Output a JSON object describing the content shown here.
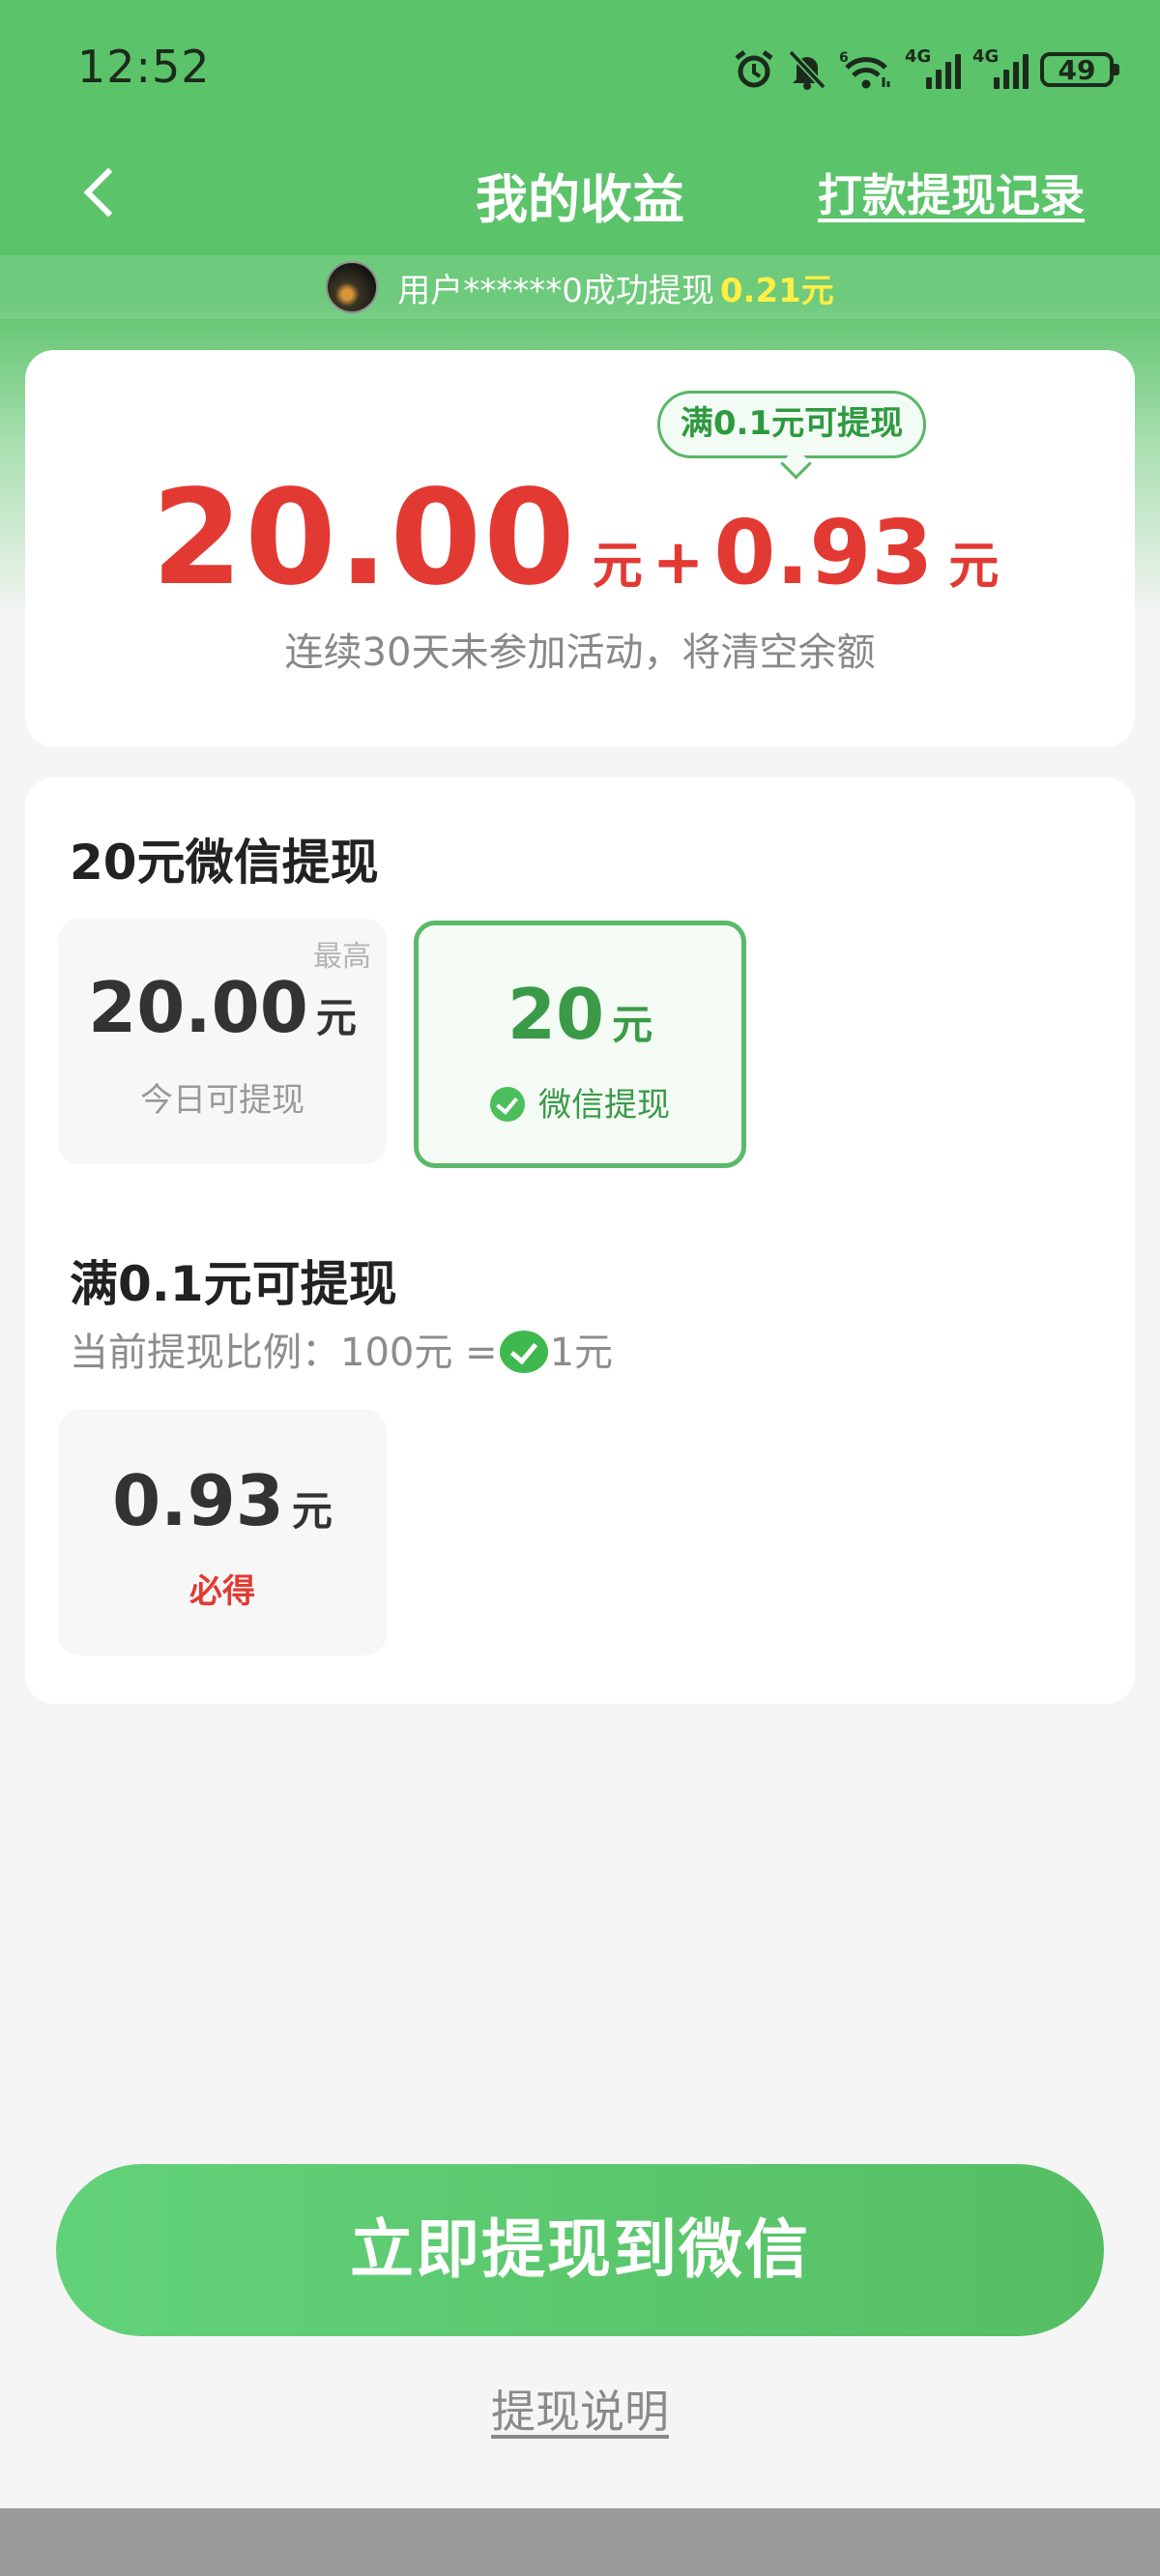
{
  "status_bar": {
    "time": "12:52",
    "network_labels": [
      "4G",
      "4G"
    ],
    "battery": "49",
    "icons": [
      "alarm-icon",
      "bell-muted-icon",
      "wifi-icon",
      "signal-icon",
      "signal-icon",
      "battery-icon"
    ]
  },
  "nav": {
    "back_icon": "chevron-left-icon",
    "title": "我的收益",
    "record_link": "打款提现记录"
  },
  "ticker": {
    "text": "用户******0成功提现",
    "amount": "0.21元"
  },
  "balance": {
    "bubble": "满0.1元可提现",
    "main_amount": "20.00",
    "main_unit": "元",
    "plus": "+",
    "extra_amount": "0.93",
    "extra_unit": "元",
    "hint": "连续30天未参加活动，将清空余额"
  },
  "wechat_section": {
    "title": "20元微信提现",
    "today_tile": {
      "tag": "最高",
      "amount": "20.00",
      "unit": "元",
      "label": "今日可提现"
    },
    "wechat_tile": {
      "amount": "20",
      "unit": "元",
      "label": "微信提现",
      "selected": true
    }
  },
  "small_section": {
    "title": "满0.1元可提现",
    "ratio_prefix": "当前提现比例：100元 =",
    "ratio_suffix": "1元",
    "tile": {
      "amount": "0.93",
      "unit": "元",
      "label": "必得"
    }
  },
  "cta_label": "立即提现到微信",
  "explain_link": "提现说明",
  "colors": {
    "brand_green": "#5bc36a",
    "amount_red": "#e23a33",
    "selected_border": "#5bb96a",
    "ticker_amount": "#ffef45"
  }
}
